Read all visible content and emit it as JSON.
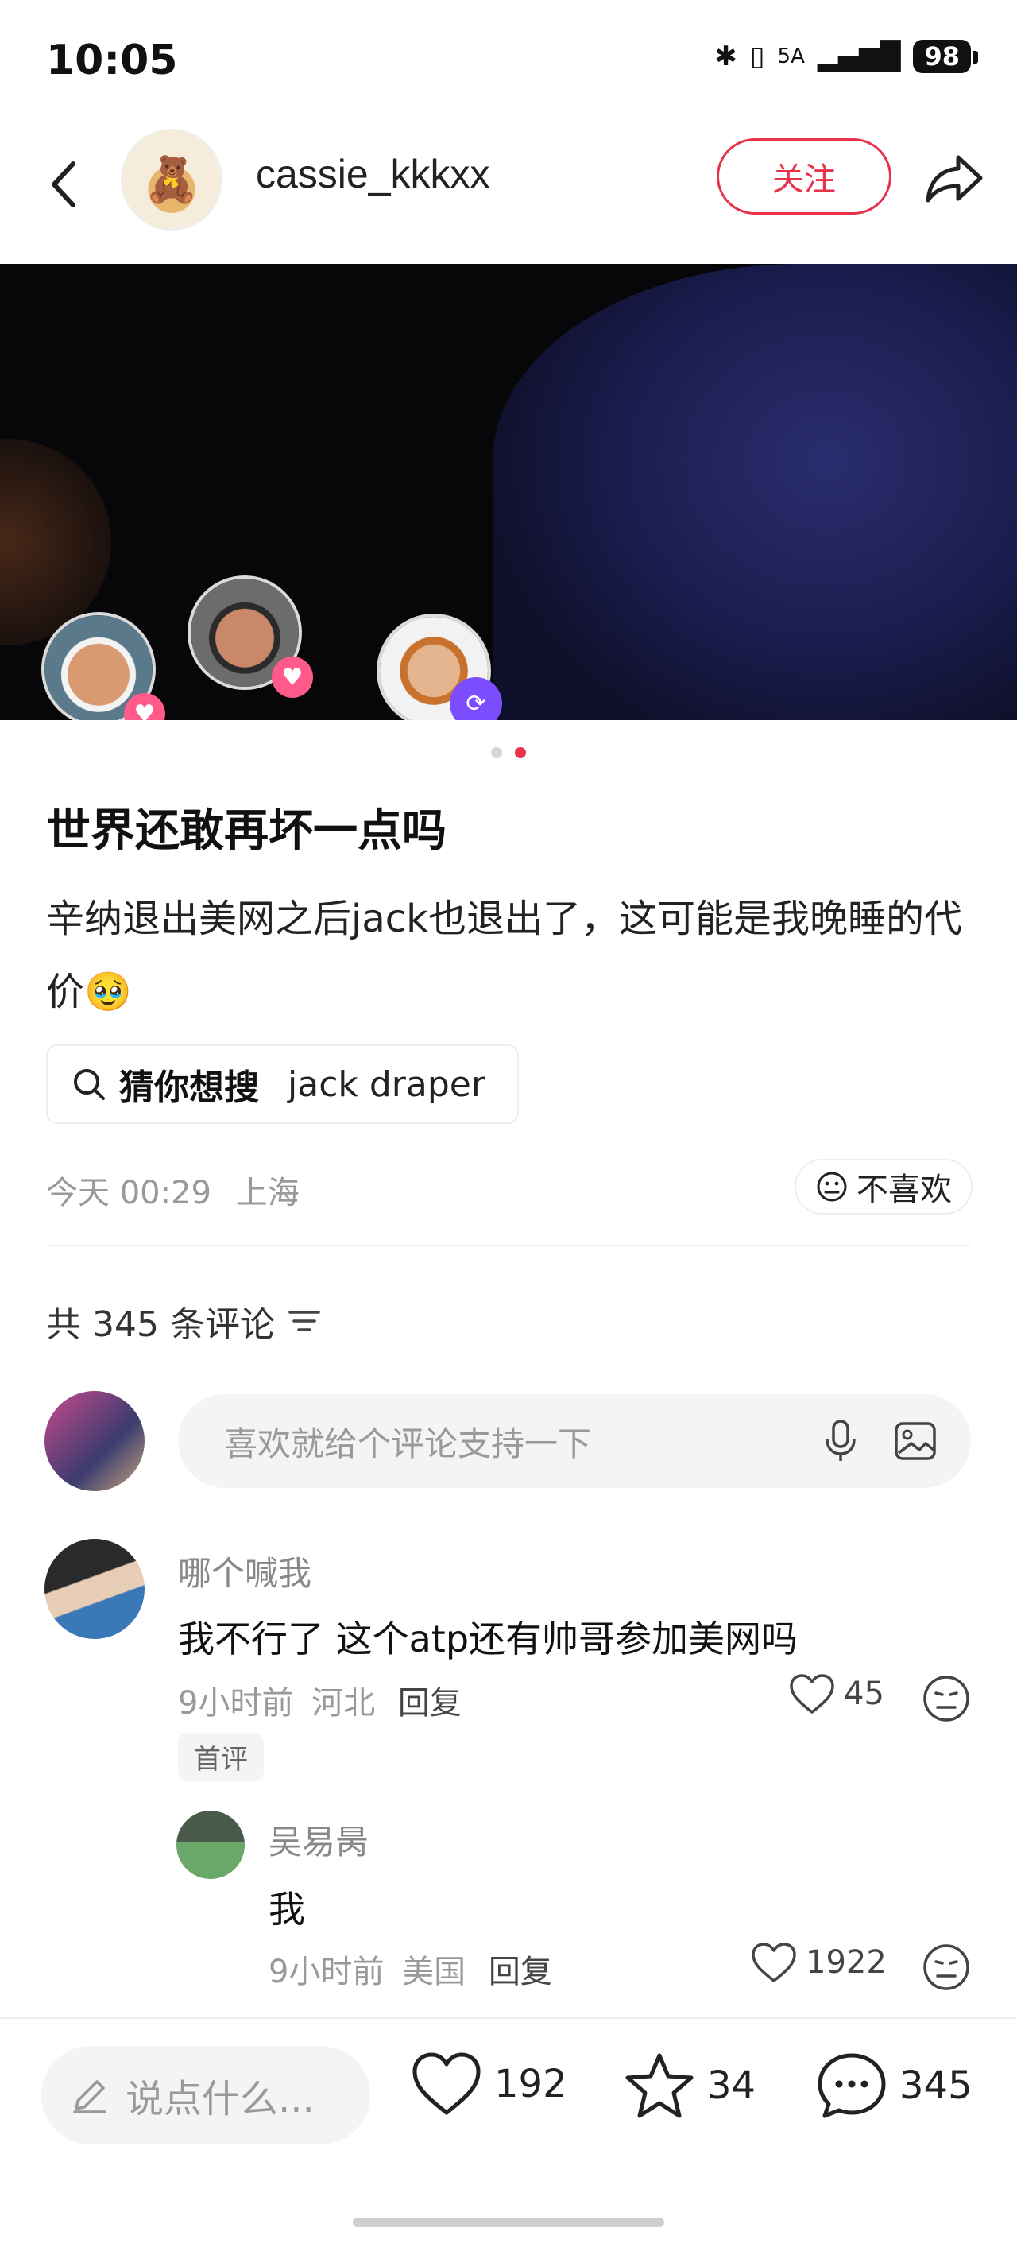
{
  "status_bar": {
    "time": "10:05",
    "network": "5A",
    "battery": "98"
  },
  "header": {
    "username": "cassie_kkkxx",
    "follow_label": "关注"
  },
  "hero": {
    "page_count": 2,
    "active_page": 2
  },
  "post": {
    "title": "世界还敢再坏一点吗",
    "body": "辛纳退出美网之后jack也退出了，这可能是我晚睡的代价🥹",
    "search_label": "猜你想搜",
    "search_term": "jack draper",
    "date": "今天 00:29",
    "location": "上海",
    "dislike_label": "不喜欢"
  },
  "comments_section": {
    "count_label": "共 345 条评论",
    "input_placeholder": "喜欢就给个评论支持一下",
    "comments": [
      {
        "name": "哪个喊我",
        "text": "我不行了 这个atp还有帅哥参加美网吗",
        "time": "9小时前",
        "location": "河北",
        "reply_label": "回复",
        "likes": "45",
        "badge": "首评"
      },
      {
        "name": "吴易昺",
        "text": "我",
        "time": "9小时前",
        "location": "美国",
        "reply_label": "回复",
        "likes": "1922"
      }
    ]
  },
  "bottom_bar": {
    "say_placeholder": "说点什么...",
    "likes": "192",
    "stars": "34",
    "comments": "345"
  },
  "colors": {
    "accent": "#e8324a"
  }
}
